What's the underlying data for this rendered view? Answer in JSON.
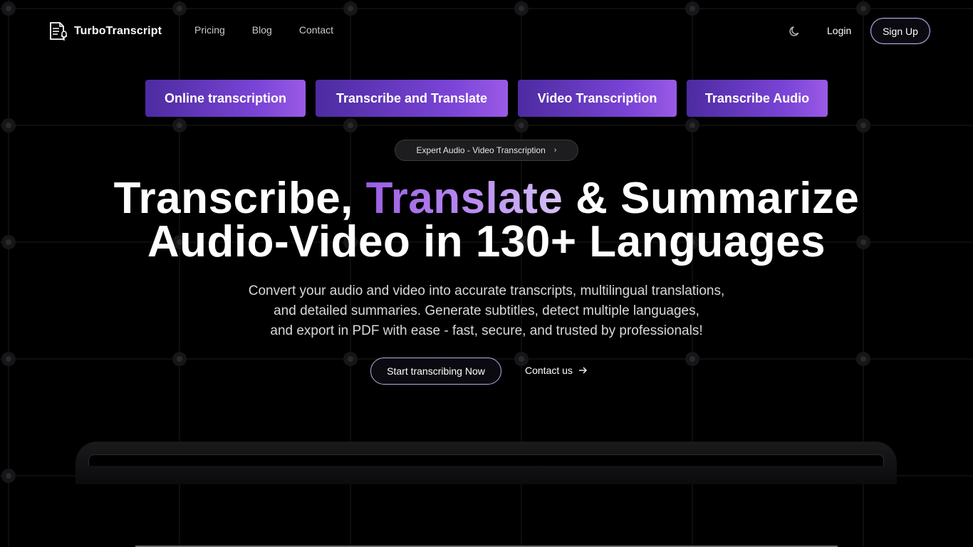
{
  "nav": {
    "brand": "TurboTranscript",
    "brand_icon": "document-microphone-icon",
    "links": [
      "Pricing",
      "Blog",
      "Contact"
    ],
    "theme_icon": "moon-icon",
    "login": "Login",
    "signup": "Sign Up"
  },
  "tabs": [
    "Online transcription",
    "Transcribe and Translate",
    "Video Transcription",
    "Transcribe Audio"
  ],
  "hero": {
    "pill_text": "Expert Audio - Video Transcription",
    "pill_icon": "chevron-right-icon",
    "headline_part1": "Transcribe, ",
    "headline_accent": "Translate",
    "headline_part2": " & Summarize",
    "headline_line2": "Audio-Video in 130+ Languages",
    "subtext_line1": "Convert your audio and video into accurate transcripts, multilingual translations,",
    "subtext_line2": "and detailed summaries. Generate subtitles, detect multiple languages,",
    "subtext_line3": "and export in PDF with ease - fast, secure, and trusted by professionals!",
    "cta_primary": "Start transcribing Now",
    "cta_secondary": "Contact us",
    "cta_secondary_icon": "arrow-right-icon"
  },
  "colors": {
    "background": "#000000",
    "accent_purple": "#9b5de5",
    "tab_gradient_start": "#4c2ba0",
    "tab_gradient_end": "#9a5ae6",
    "button_border": "#b8aee0"
  }
}
